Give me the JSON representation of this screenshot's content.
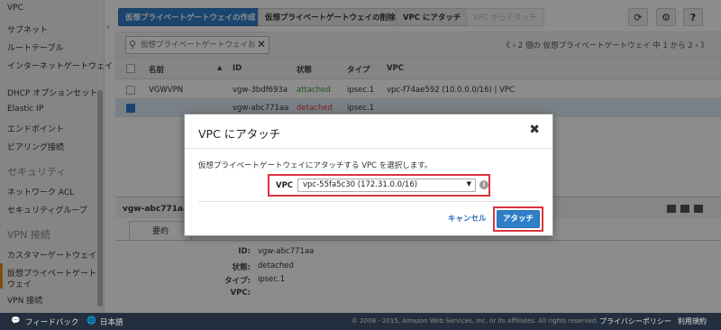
{
  "sidebar": {
    "items": [
      {
        "label": "VPC"
      },
      {
        "label": "サブネット"
      },
      {
        "label": "ルートテーブル"
      },
      {
        "label": "インターネットゲートウェイ"
      },
      {
        "label": "DHCP オプションセット"
      },
      {
        "label": "Elastic IP"
      },
      {
        "label": "エンドポイント"
      },
      {
        "label": "ピアリング接続"
      }
    ],
    "security_header": "セキュリティ",
    "security_items": [
      {
        "label": "ネットワーク ACL"
      },
      {
        "label": "セキュリティグループ"
      }
    ],
    "vpn_header": "VPN 接続",
    "vpn_items": [
      {
        "label": "カスタマーゲートウェイ"
      },
      {
        "label": "仮想プライベートゲート"
      },
      {
        "label": "ウェイ"
      },
      {
        "label": "VPN 接続"
      }
    ],
    "collapse_icon": "‹"
  },
  "toolbar": {
    "create_label": "仮想プライベートゲートウェイの作成",
    "delete_label": "仮想プライベートゲートウェイの削除",
    "attach_label": "VPC にアタッチ",
    "detach_label": "VPC からデタッチ",
    "refresh_icon": "⟳",
    "settings_icon": "⚙",
    "help_icon": "?"
  },
  "filter": {
    "placeholder": "仮想プライベートゲートウェイお",
    "pager": "《 ‹ 2 個の 仮想プライベートゲートウェイ 中 1 から 2 › 》"
  },
  "table": {
    "headers": {
      "name": "名前",
      "id": "ID",
      "state": "状態",
      "type": "タイプ",
      "vpc": "VPC"
    },
    "rows": [
      {
        "name": "VGWVPN",
        "id": "vgw-3bdf693a",
        "state": "attached",
        "type": "ipsec.1",
        "vpc": "vpc-f74ae592 (10.0.0.0/16) | VPC"
      },
      {
        "name": "",
        "id": "vgw-abc771aa",
        "state": "detached",
        "type": "ipsec.1",
        "vpc": ""
      }
    ]
  },
  "detail": {
    "id": "vgw-abc771aa",
    "tab_summary": "要約",
    "fields": [
      {
        "label": "ID:",
        "value": "vgw-abc771aa"
      },
      {
        "label": "状態:",
        "value": "detached"
      },
      {
        "label": "タイプ:",
        "value": "ipsec.1"
      },
      {
        "label": "VPC:",
        "value": ""
      }
    ]
  },
  "modal": {
    "title": "VPC にアタッチ",
    "close_icon": "✖",
    "description": "仮想プライベートゲートウェイにアタッチする VPC を選択します。",
    "vpc_label": "VPC",
    "vpc_selected": "vpc-55fa5c30 (172.31.0.0/16)",
    "info_icon": "i",
    "cancel_label": "キャンセル",
    "attach_label": "アタッチ"
  },
  "footer": {
    "feedback": "フィードバック",
    "language": "日本語",
    "copyright": "© 2008 - 2015, Amazon Web Services, Inc. or its affiliates. All rights reserved.",
    "privacy": "プライバシーポリシー",
    "terms": "利用規約"
  },
  "colors": {
    "primary": "#2f7fc8",
    "highlight_border": "#d9363e",
    "attached": "#3a9a3a",
    "detached": "#d9363e",
    "active_nav": "#e58e1a",
    "footer_bg": "#232f3e"
  }
}
